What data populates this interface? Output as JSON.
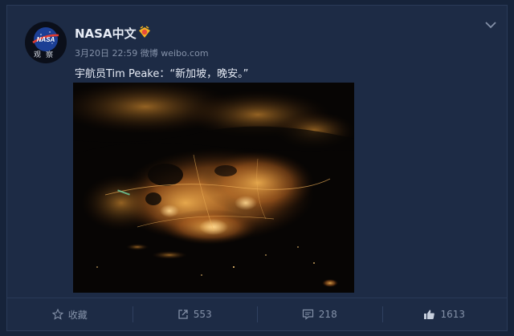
{
  "post": {
    "author": "NASA中文",
    "avatar_caption": "观察",
    "timestamp": "3月20日 22:59",
    "source": "微博 weibo.com",
    "text": "宇航员Tim Peake：“新加坡，晚安。”"
  },
  "actions": {
    "favorite": "收藏",
    "repost": "553",
    "comment": "218",
    "like": "1613"
  },
  "icons": {
    "verified": "verified-badge-icon",
    "menu": "chevron-down-icon",
    "favorite": "star-icon",
    "repost": "share-icon",
    "comment": "comment-icon",
    "like": "thumbs-up-icon"
  },
  "colors": {
    "page_bg": "#16233a",
    "card_bg": "#1d2b45",
    "primary_text": "#e6ebf5",
    "secondary_text": "#8491a8",
    "city_lights": "#e8a040"
  }
}
